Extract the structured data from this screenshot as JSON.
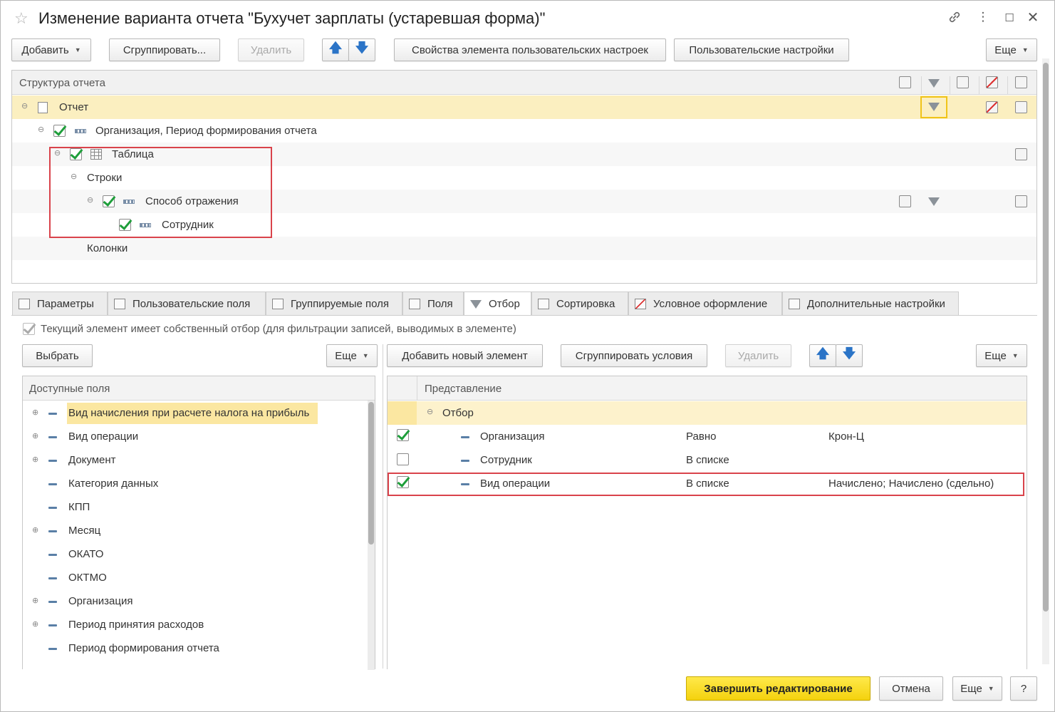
{
  "window": {
    "title": "Изменение варианта отчета \"Бухучет зарплаты (устаревшая форма)\"",
    "controls": [
      "link-icon",
      "more-icon",
      "maximize-icon",
      "close-icon"
    ]
  },
  "toolbar": {
    "add": "Добавить",
    "group": "Сгруппировать...",
    "delete": "Удалить",
    "element_props": "Свойства элемента пользовательских настроек",
    "user_settings": "Пользовательские настройки",
    "more": "Еще"
  },
  "structure": {
    "header": "Структура отчета",
    "rows": [
      {
        "label": "Отчет"
      },
      {
        "label": "Организация, Период формирования отчета"
      },
      {
        "label": "Таблица"
      },
      {
        "label": "Строки"
      },
      {
        "label": "Способ отражения"
      },
      {
        "label": "Сотрудник"
      },
      {
        "label": "Колонки"
      }
    ]
  },
  "tabs": [
    {
      "label": "Параметры"
    },
    {
      "label": "Пользовательские поля"
    },
    {
      "label": "Группируемые поля"
    },
    {
      "label": "Поля"
    },
    {
      "label": "Отбор",
      "active": true
    },
    {
      "label": "Сортировка"
    },
    {
      "label": "Условное оформление"
    },
    {
      "label": "Дополнительные настройки"
    }
  ],
  "filter_tab": {
    "own_filter_label": "Текущий элемент имеет собственный отбор (для фильтрации записей, выводимых в элементе)",
    "select": "Выбрать",
    "more": "Еще",
    "add_new": "Добавить новый элемент",
    "group_conditions": "Сгруппировать условия",
    "delete": "Удалить",
    "more2": "Еще",
    "available_header": "Доступные поля",
    "available_fields": [
      {
        "label": "Вид начисления при расчете налога на прибыль"
      },
      {
        "label": "Вид операции"
      },
      {
        "label": "Документ"
      },
      {
        "label": "Категория данных"
      },
      {
        "label": "КПП"
      },
      {
        "label": "Месяц"
      },
      {
        "label": "ОКАТО"
      },
      {
        "label": "ОКТМО"
      },
      {
        "label": "Организация"
      },
      {
        "label": "Период принятия расходов"
      },
      {
        "label": "Период формирования отчета"
      }
    ],
    "conditions_header": "Представление",
    "group_label": "Отбор",
    "conditions": [
      {
        "field": "Организация",
        "op": "Равно",
        "value": "Крон-Ц"
      },
      {
        "field": "Сотрудник",
        "op": "В списке",
        "value": ""
      },
      {
        "field": "Вид операции",
        "op": "В списке",
        "value": "Начислено; Начислено (сдельно)"
      }
    ]
  },
  "footer": {
    "finish": "Завершить редактирование",
    "cancel": "Отмена",
    "more": "Еще",
    "help": "?"
  },
  "colors": {
    "selected_row": "#fbefc0",
    "primary_button": "#f4d20e",
    "highlight_frame": "#d9434b",
    "check": "#1e9e3a"
  }
}
